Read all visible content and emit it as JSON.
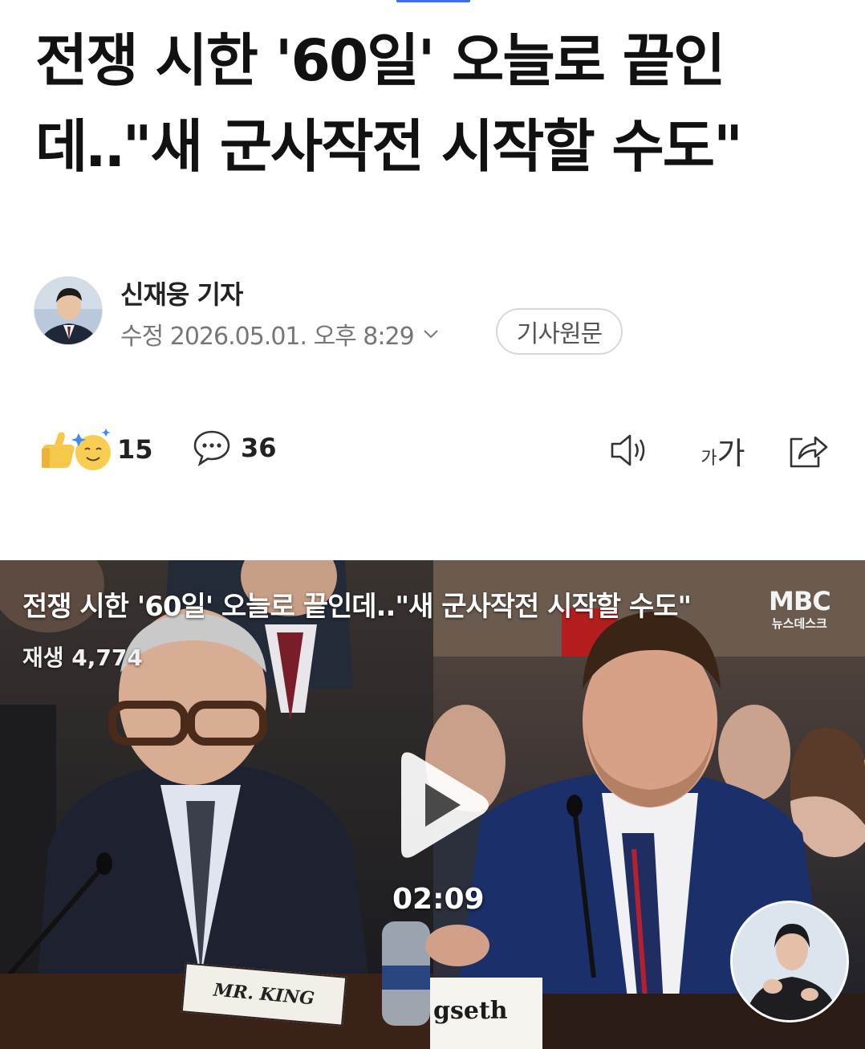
{
  "article": {
    "headline": "전쟁 시한 '60일' 오늘로 끝인데‥\"새 군사작전 시작할 수도\"",
    "author": "신재웅 기자",
    "date": "수정 2026.05.01. 오후 8:29",
    "original_label": "기사원문"
  },
  "actions": {
    "reaction_count": "15",
    "comment_count": "36",
    "font_small": "가",
    "font_large": "가",
    "icons": [
      "reaction-icon",
      "comment-icon",
      "speaker-icon",
      "font-size-icon",
      "share-icon"
    ]
  },
  "video": {
    "title": "전쟁 시한 '60일' 오늘로 끝인데..\"새 군사작전 시작할 수도\"",
    "views": "재생 4,774",
    "duration": "02:09",
    "logo_main": "MBC",
    "logo_sub": "뉴스데스크",
    "nameplate_left": "MR. KING",
    "nameplate_right": "gseth"
  },
  "colors": {
    "accent": "#3b6ee8",
    "text": "#111111",
    "muted": "#777777"
  }
}
